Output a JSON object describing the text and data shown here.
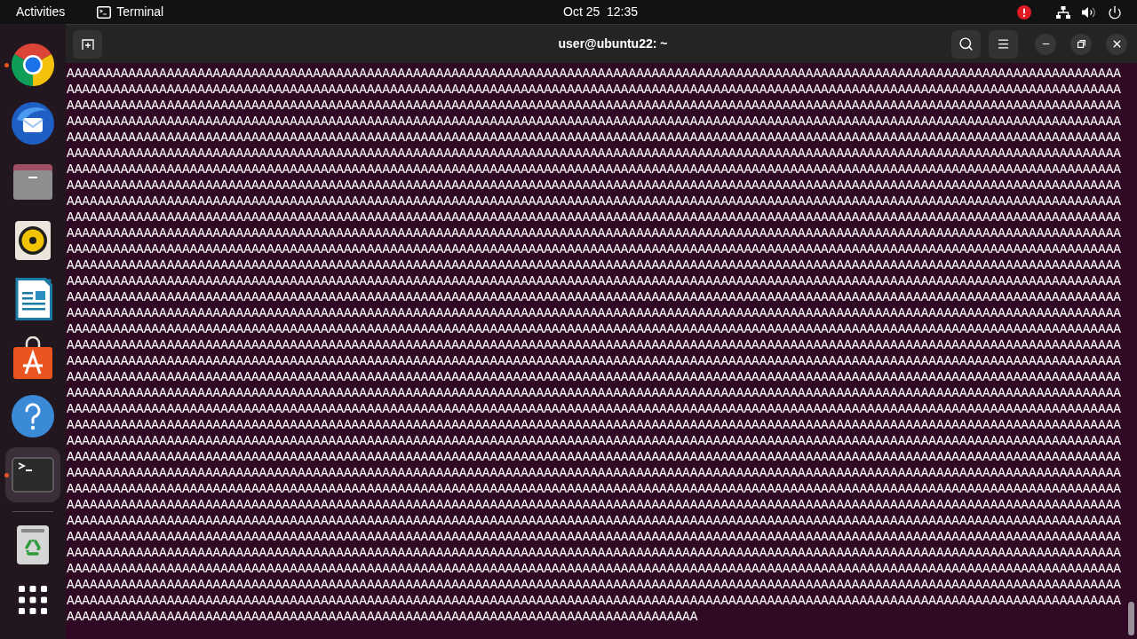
{
  "top_bar": {
    "activities": "Activities",
    "app_menu": {
      "label": "Terminal"
    },
    "clock": "Oct 25  12:35",
    "status": [
      {
        "kind": "alert"
      },
      {
        "kind": "network"
      },
      {
        "kind": "volume"
      },
      {
        "kind": "power"
      }
    ]
  },
  "dock": {
    "items": [
      {
        "kind": "browser",
        "running": true,
        "selected": false
      },
      {
        "kind": "mail",
        "running": false,
        "selected": false
      },
      {
        "kind": "folder",
        "running": false,
        "selected": false
      },
      {
        "kind": "speaker",
        "running": false,
        "selected": false
      },
      {
        "kind": "document",
        "running": false,
        "selected": false
      },
      {
        "kind": "bag",
        "running": false,
        "selected": false
      },
      {
        "kind": "help",
        "running": false,
        "selected": false
      },
      {
        "kind": "terminal",
        "running": true,
        "selected": true
      }
    ],
    "bottom_items": [
      {
        "kind": "trash"
      },
      {
        "kind": "app-grid"
      }
    ]
  },
  "window": {
    "title": "user@ubuntu22: ~",
    "lines": [
      "AAAAAAAAAAAAAAAAAAAAAAAAAAAAAAAAAAAAAAAAAAAAAAAAAAAAAAAAAAAAAAAAAAAAAAAAAAAAAAAAAAAAAAAAAAAAAAAAAAAAAAAAAAAAAAAAAAAAAAAAAAAAAAAAAAAAAAAAA",
      "AAAAAAAAAAAAAAAAAAAAAAAAAAAAAAAAAAAAAAAAAAAAAAAAAAAAAAAAAAAAAAAAAAAAAAAAAAAAAAAAAAAAAAAAAAAAAAAAAAAAAAAAAAAAAAAAAAAAAAAAAAAAAAAAAAAAAAAAA",
      "AAAAAAAAAAAAAAAAAAAAAAAAAAAAAAAAAAAAAAAAAAAAAAAAAAAAAAAAAAAAAAAAAAAAAAAAAAAAAAAAAAAAAAAAAAAAAAAAAAAAAAAAAAAAAAAAAAAAAAAAAAAAAAAAAAAAAAAAA",
      "AAAAAAAAAAAAAAAAAAAAAAAAAAAAAAAAAAAAAAAAAAAAAAAAAAAAAAAAAAAAAAAAAAAAAAAAAAAAAAAAAAAAAAAAAAAAAAAAAAAAAAAAAAAAAAAAAAAAAAAAAAAAAAAAAAAAAAAAA",
      "AAAAAAAAAAAAAAAAAAAAAAAAAAAAAAAAAAAAAAAAAAAAAAAAAAAAAAAAAAAAAAAAAAAAAAAAAAAAAAAAAAAAAAAAAAAAAAAAAAAAAAAAAAAAAAAAAAAAAAAAAAAAAAAAAAAAAAAAA",
      "AAAAAAAAAAAAAAAAAAAAAAAAAAAAAAAAAAAAAAAAAAAAAAAAAAAAAAAAAAAAAAAAAAAAAAAAAAAAAAAAAAAAAAAAAAAAAAAAAAAAAAAAAAAAAAAAAAAAAAAAAAAAAAAAAAAAAAAAA",
      "AAAAAAAAAAAAAAAAAAAAAAAAAAAAAAAAAAAAAAAAAAAAAAAAAAAAAAAAAAAAAAAAAAAAAAAAAAAAAAAAAAAAAAAAAAAAAAAAAAAAAAAAAAAAAAAAAAAAAAAAAAAAAAAAAAAAAAAAA",
      "AAAAAAAAAAAAAAAAAAAAAAAAAAAAAAAAAAAAAAAAAAAAAAAAAAAAAAAAAAAAAAAAAAAAAAAAAAAAAAAAAAAAAAAAAAAAAAAAAAAAAAAAAAAAAAAAAAAAAAAAAAAAAAAAAAAAAAAAA",
      "AAAAAAAAAAAAAAAAAAAAAAAAAAAAAAAAAAAAAAAAAAAAAAAAAAAAAAAAAAAAAAAAAAAAAAAAAAAAAAAAAAAAAAAAAAAAAAAAAAAAAAAAAAAAAAAAAAAAAAAAAAAAAAAAAAAAAAAAA",
      "AAAAAAAAAAAAAAAAAAAAAAAAAAAAAAAAAAAAAAAAAAAAAAAAAAAAAAAAAAAAAAAAAAAAAAAAAAAAAAAAAAAAAAAAAAAAAAAAAAAAAAAAAAAAAAAAAAAAAAAAAAAAAAAAAAAAAAAAA",
      "AAAAAAAAAAAAAAAAAAAAAAAAAAAAAAAAAAAAAAAAAAAAAAAAAAAAAAAAAAAAAAAAAAAAAAAAAAAAAAAAAAAAAAAAAAAAAAAAAAAAAAAAAAAAAAAAAAAAAAAAAAAAAAAAAAAAAAAAA",
      "AAAAAAAAAAAAAAAAAAAAAAAAAAAAAAAAAAAAAAAAAAAAAAAAAAAAAAAAAAAAAAAAAAAAAAAAAAAAAAAAAAAAAAAAAAAAAAAAAAAAAAAAAAAAAAAAAAAAAAAAAAAAAAAAAAAAAAAAA",
      "AAAAAAAAAAAAAAAAAAAAAAAAAAAAAAAAAAAAAAAAAAAAAAAAAAAAAAAAAAAAAAAAAAAAAAAAAAAAAAAAAAAAAAAAAAAAAAAAAAAAAAAAAAAAAAAAAAAAAAAAAAAAAAAAAAAAAAAAA",
      "AAAAAAAAAAAAAAAAAAAAAAAAAAAAAAAAAAAAAAAAAAAAAAAAAAAAAAAAAAAAAAAAAAAAAAAAAAAAAAAAAAAAAAAAAAAAAAAAAAAAAAAAAAAAAAAAAAAAAAAAAAAAAAAAAAAAAAAAA",
      "AAAAAAAAAAAAAAAAAAAAAAAAAAAAAAAAAAAAAAAAAAAAAAAAAAAAAAAAAAAAAAAAAAAAAAAAAAAAAAAAAAAAAAAAAAAAAAAAAAAAAAAAAAAAAAAAAAAAAAAAAAAAAAAAAAAAAAAAA",
      "AAAAAAAAAAAAAAAAAAAAAAAAAAAAAAAAAAAAAAAAAAAAAAAAAAAAAAAAAAAAAAAAAAAAAAAAAAAAAAAAAAAAAAAAAAAAAAAAAAAAAAAAAAAAAAAAAAAAAAAAAAAAAAAAAAAAAAAAA",
      "AAAAAAAAAAAAAAAAAAAAAAAAAAAAAAAAAAAAAAAAAAAAAAAAAAAAAAAAAAAAAAAAAAAAAAAAAAAAAAAAAAAAAAAAAAAAAAAAAAAAAAAAAAAAAAAAAAAAAAAAAAAAAAAAAAAAAAAAA",
      "AAAAAAAAAAAAAAAAAAAAAAAAAAAAAAAAAAAAAAAAAAAAAAAAAAAAAAAAAAAAAAAAAAAAAAAAAAAAAAAAAAAAAAAAAAAAAAAAAAAAAAAAAAAAAAAAAAAAAAAAAAAAAAAAAAAAAAAAA",
      "AAAAAAAAAAAAAAAAAAAAAAAAAAAAAAAAAAAAAAAAAAAAAAAAAAAAAAAAAAAAAAAAAAAAAAAAAAAAAAAAAAAAAAAAAAAAAAAAAAAAAAAAAAAAAAAAAAAAAAAAAAAAAAAAAAAAAAAAA",
      "AAAAAAAAAAAAAAAAAAAAAAAAAAAAAAAAAAAAAAAAAAAAAAAAAAAAAAAAAAAAAAAAAAAAAAAAAAAAAAAAAAAAAAAAAAAAAAAAAAAAAAAAAAAAAAAAAAAAAAAAAAAAAAAAAAAAAAAAA",
      "AAAAAAAAAAAAAAAAAAAAAAAAAAAAAAAAAAAAAAAAAAAAAAAAAAAAAAAAAAAAAAAAAAAAAAAAAAAAAAAAAAAAAAAAAAAAAAAAAAAAAAAAAAAAAAAAAAAAAAAAAAAAAAAAAAAAAAAAA",
      "AAAAAAAAAAAAAAAAAAAAAAAAAAAAAAAAAAAAAAAAAAAAAAAAAAAAAAAAAAAAAAAAAAAAAAAAAAAAAAAAAAAAAAAAAAAAAAAAAAAAAAAAAAAAAAAAAAAAAAAAAAAAAAAAAAAAAAAAA",
      "AAAAAAAAAAAAAAAAAAAAAAAAAAAAAAAAAAAAAAAAAAAAAAAAAAAAAAAAAAAAAAAAAAAAAAAAAAAAAAAAAAAAAAAAAAAAAAAAAAAAAAAAAAAAAAAAAAAAAAAAAAAAAAAAAAAAAAAAA",
      "AAAAAAAAAAAAAAAAAAAAAAAAAAAAAAAAAAAAAAAAAAAAAAAAAAAAAAAAAAAAAAAAAAAAAAAAAAAAAAAAAAAAAAAAAAAAAAAAAAAAAAAAAAAAAAAAAAAAAAAAAAAAAAAAAAAAAAAAA",
      "AAAAAAAAAAAAAAAAAAAAAAAAAAAAAAAAAAAAAAAAAAAAAAAAAAAAAAAAAAAAAAAAAAAAAAAAAAAAAAAAAAAAAAAAAAAAAAAAAAAAAAAAAAAAAAAAAAAAAAAAAAAAAAAAAAAAAAAAA",
      "AAAAAAAAAAAAAAAAAAAAAAAAAAAAAAAAAAAAAAAAAAAAAAAAAAAAAAAAAAAAAAAAAAAAAAAAAAAAAAAAAAAAAAAAAAAAAAAAAAAAAAAAAAAAAAAAAAAAAAAAAAAAAAAAAAAAAAAAA",
      "AAAAAAAAAAAAAAAAAAAAAAAAAAAAAAAAAAAAAAAAAAAAAAAAAAAAAAAAAAAAAAAAAAAAAAAAAAAAAAAAAAAAAAAAAAAAAAAAAAAAAAAAAAAAAAAAAAAAAAAAAAAAAAAAAAAAAAAAA",
      "AAAAAAAAAAAAAAAAAAAAAAAAAAAAAAAAAAAAAAAAAAAAAAAAAAAAAAAAAAAAAAAAAAAAAAAAAAAAAAAAAAAAAAAAAAAAAAAAAAAAAAAAAAAAAAAAAAAAAAAAAAAAAAAAAAAAAAAAA",
      "AAAAAAAAAAAAAAAAAAAAAAAAAAAAAAAAAAAAAAAAAAAAAAAAAAAAAAAAAAAAAAAAAAAAAAAAAAAAAAAAAAAAAAAAAAAAAAAAAAAAAAAAAAAAAAAAAAAAAAAAAAAAAAAAAAAAAAAAA",
      "AAAAAAAAAAAAAAAAAAAAAAAAAAAAAAAAAAAAAAAAAAAAAAAAAAAAAAAAAAAAAAAAAAAAAAAAAAAAAAAAAAAAAAAAAAAAAAAAAAAAAAAAAAAAAAAAAAAAAAAAAAAAAAAAAAAAAAAAA",
      "AAAAAAAAAAAAAAAAAAAAAAAAAAAAAAAAAAAAAAAAAAAAAAAAAAAAAAAAAAAAAAAAAAAAAAAAAAAAAAAAAAAAAAAAAAAAAAAAAAAAAAAAAAAAAAAAAAAAAAAAAAAAAAAAAAAAAAAAA",
      "AAAAAAAAAAAAAAAAAAAAAAAAAAAAAAAAAAAAAAAAAAAAAAAAAAAAAAAAAAAAAAAAAAAAAAAAAAAAAAAAAAAAAAAAAAAAAAAAAAAAAAAAAAAAAAAAAAAAAAAAAAAAAAAAAAAAAAAAA",
      "AAAAAAAAAAAAAAAAAAAAAAAAAAAAAAAAAAAAAAAAAAAAAAAAAAAAAAAAAAAAAAAAAAAAAAAAAAAAAAAAAAAAAAAAAAAAAAAAAAAAAAAAAAAAAAAAAAAAAAAAAAAAAAAAAAAAAAAAA",
      "AAAAAAAAAAAAAAAAAAAAAAAAAAAAAAAAAAAAAAAAAAAAAAAAAAAAAAAAAAAAAAAAAAAAAAAAAAAAAAAAAAAAAAAAAAAAAAAAAAAAAAAAAAAAAAAAAAAAAAAAAAAAAAAAAAAAAAAAA",
      "AAAAAAAAAAAAAAAAAAAAAAAAAAAAAAAAAAAAAAAAAAAAAAAAAAAAAAAAAAAAAAAAAAAAAAAAAAAAAAAAAA"
    ]
  }
}
